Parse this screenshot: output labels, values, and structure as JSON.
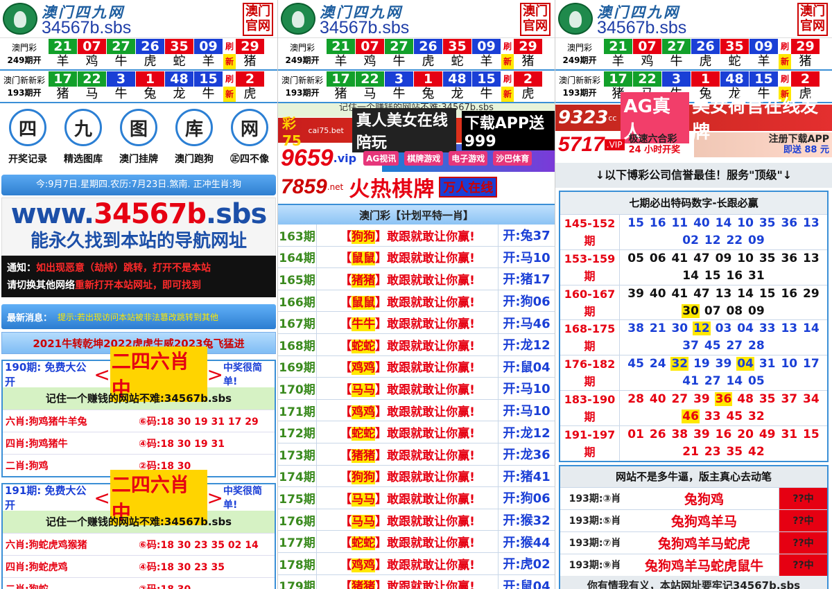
{
  "header": {
    "name": "澳门四九网",
    "domain": "34567b.sbs",
    "badge_top": "澳门",
    "badge_bottom": "官网"
  },
  "macau": {
    "label": "澳門彩",
    "period": "249期开",
    "refresh": [
      "刷",
      "新"
    ],
    "balls": [
      {
        "n": "21",
        "z": "羊",
        "c": "g"
      },
      {
        "n": "07",
        "z": "鸡",
        "c": "r"
      },
      {
        "n": "27",
        "z": "牛",
        "c": "g"
      },
      {
        "n": "26",
        "z": "虎",
        "c": "b"
      },
      {
        "n": "35",
        "z": "蛇",
        "c": "r"
      },
      {
        "n": "09",
        "z": "羊",
        "c": "b"
      }
    ],
    "special": {
      "n": "29",
      "z": "猪",
      "c": "r"
    }
  },
  "newmacau": {
    "label": "澳门新新彩",
    "period": "193期开",
    "refresh": [
      "刷",
      "新"
    ],
    "balls": [
      {
        "n": "17",
        "z": "猪",
        "c": "g"
      },
      {
        "n": "22",
        "z": "马",
        "c": "g"
      },
      {
        "n": "3",
        "z": "牛",
        "c": "b"
      },
      {
        "n": "1",
        "z": "兔",
        "c": "r"
      },
      {
        "n": "48",
        "z": "龙",
        "c": "b"
      },
      {
        "n": "15",
        "z": "牛",
        "c": "b"
      }
    ],
    "special": {
      "n": "2",
      "z": "虎",
      "c": "r"
    }
  },
  "col1": {
    "nav": [
      {
        "glyph": "四",
        "label": "开奖记录"
      },
      {
        "glyph": "九",
        "label": "精选图库"
      },
      {
        "glyph": "图",
        "label": "澳门挂牌"
      },
      {
        "glyph": "库",
        "label": "澳门跑狗"
      },
      {
        "glyph": "网",
        "label": "㊣四不像"
      }
    ],
    "date": "今:9月7日.星期四.农历:7月23日.煞南. 正冲生肖:狗",
    "url_pre": "www.",
    "url_num": "34567b",
    "url_post": ".sbs",
    "url_sub": "能永久找到本站的导航网址",
    "notice_1a": "通知：",
    "notice_1b": "如出现恶意（劫持）跳转，打开不是本站",
    "notice_2a": "请切换其他网络",
    "notice_2b": "重新打开本站网址，即可找到",
    "msg_label": "最新消息：",
    "msg_text": "提示:若出现访问本站被非法篡改跳转到其他",
    "slogan": "2021牛转乾坤2022虎虎生威2023兔飞猛进",
    "blocks": [
      {
        "pre": "190期: 免费大公开",
        "mid": "二四六肖中",
        "post": "中奖很简单!",
        "remember": "记住一个赚钱的网站不难:34567b.sbs",
        "rows": [
          {
            "a1": "六肖:",
            "a2": "狗鸡猪牛羊兔",
            "c1": "⑥码:",
            "c2": "18 30 19 31 17 29"
          },
          {
            "a1": "四肖:",
            "a2": "狗鸡猪牛",
            "c1": "④码:",
            "c2": "18 30 19 31"
          },
          {
            "a1": "二肖:",
            "a2": "狗鸡",
            "c1": "②码:",
            "c2": "18 30"
          }
        ]
      },
      {
        "pre": "191期: 免费大公开",
        "mid": "二四六肖中",
        "post": "中奖很简单!",
        "remember": "记住一个赚钱的网站不难:34567b.sbs",
        "rows": [
          {
            "a1": "六肖:",
            "a2": "狗蛇虎鸡猴猪",
            "c1": "⑥码:",
            "c2": "18 30 23 35 02 14"
          },
          {
            "a1": "四肖:",
            "a2": "狗蛇虎鸡",
            "c1": "④码:",
            "c2": "18 30 23 35"
          },
          {
            "a1": "二肖:",
            "a2": "狗蛇",
            "c1": "②码:",
            "c2": "18 30"
          }
        ]
      }
    ]
  },
  "col2": {
    "strip": "记住一个赚钱的网站不难:34567b.sbs",
    "ad1": {
      "logo": "彩75",
      "domain": "cai75.bet",
      "text": "真人美女在线陪玩",
      "text2": "下载APP送999"
    },
    "ad2": {
      "num": "9659",
      "vip": ".vip",
      "tags": [
        "AG视讯",
        "棋牌游戏",
        "电子游戏",
        "沙巴体育"
      ]
    },
    "ad3": {
      "num": "7859",
      "net": ".net",
      "text": "火热棋牌",
      "badge": "万人在线"
    },
    "plan_title": "澳门彩【计划平特一肖】",
    "rows": [
      {
        "p": "163期",
        "z": "狗狗",
        "k": "开:兔37"
      },
      {
        "p": "164期",
        "z": "鼠鼠",
        "k": "开:马10"
      },
      {
        "p": "165期",
        "z": "猪猪",
        "k": "开:猪17"
      },
      {
        "p": "166期",
        "z": "鼠鼠",
        "k": "开:狗06"
      },
      {
        "p": "167期",
        "z": "牛牛",
        "k": "开:马46"
      },
      {
        "p": "168期",
        "z": "蛇蛇",
        "k": "开:龙12"
      },
      {
        "p": "169期",
        "z": "鸡鸡",
        "k": "开:鼠04"
      },
      {
        "p": "170期",
        "z": "马马",
        "k": "开:马10"
      },
      {
        "p": "171期",
        "z": "鸡鸡",
        "k": "开:马10"
      },
      {
        "p": "172期",
        "z": "蛇蛇",
        "k": "开:龙12"
      },
      {
        "p": "173期",
        "z": "猪猪",
        "k": "开:龙36"
      },
      {
        "p": "174期",
        "z": "狗狗",
        "k": "开:猪41"
      },
      {
        "p": "175期",
        "z": "马马",
        "k": "开:狗06"
      },
      {
        "p": "176期",
        "z": "马马",
        "k": "开:猴32"
      },
      {
        "p": "177期",
        "z": "蛇蛇",
        "k": "开:猴44"
      },
      {
        "p": "178期",
        "z": "鸡鸡",
        "k": "开:虎02"
      },
      {
        "p": "179期",
        "z": "猪猪",
        "k": "开:鼠04"
      }
    ],
    "dare": "敢跟就敢让你赢!"
  },
  "col3": {
    "ad4": {
      "num": "9323",
      "sub": "cc",
      "t1": "AG真人",
      "t2": "美女荷官在线发牌"
    },
    "ad5": {
      "num": "5717",
      "vip": ".VIP",
      "t1": "极速六合彩",
      "t2": "24 小时开奖",
      "d1": "注册下载APP",
      "d2": "即送 88 元"
    },
    "bc_title": "↓以下博彩公司信誉最佳！服务\"顶级\"↓",
    "frame_title": "七期必出特码数字-长跟必赢",
    "s7": [
      {
        "p": "145-152期",
        "nums": "15 16 11 40 14 10 35 36 13 02 12 22 09",
        "hl": []
      },
      {
        "p": "153-159期",
        "nums": "05 06 41 47 09 10 35 36 13 14 15 16 31",
        "hl": []
      },
      {
        "p": "160-167期",
        "nums": "39 40 41 47 13 14 15 16 29 30 07 08 09",
        "hl": [
          "30"
        ]
      },
      {
        "p": "168-175期",
        "nums": "38 21 30 12 03 04 33 13 14 37 45 27 28",
        "hl": [
          "12"
        ]
      },
      {
        "p": "176-182期",
        "nums": "45 24 32 19 39 04 31 10 17 41 27 14 05",
        "hl": [
          "32",
          "04"
        ]
      },
      {
        "p": "183-190期",
        "nums": "28 40 27 39 36 48 35 37 34 46 33 45 32",
        "hl": [
          "36",
          "46"
        ]
      },
      {
        "p": "191-197期",
        "nums": "01 26 38 39 16 20 49 31 15 21 23 35 42",
        "hl": []
      }
    ],
    "frame2_title": "网站不是多牛逼，版主真心去动笔",
    "zrows": [
      {
        "p": "193期:③肖",
        "z": "兔狗鸡",
        "r": "??中"
      },
      {
        "p": "193期:⑤肖",
        "z": "兔狗鸡羊马",
        "r": "??中"
      },
      {
        "p": "193期:⑦肖",
        "z": "兔狗鸡羊马蛇虎",
        "r": "??中"
      },
      {
        "p": "193期:⑨肖",
        "z": "兔狗鸡羊马蛇虎鼠牛",
        "r": "??中"
      }
    ],
    "foot": "你有情我有义，本站网址要牢记34567b.sbs"
  }
}
